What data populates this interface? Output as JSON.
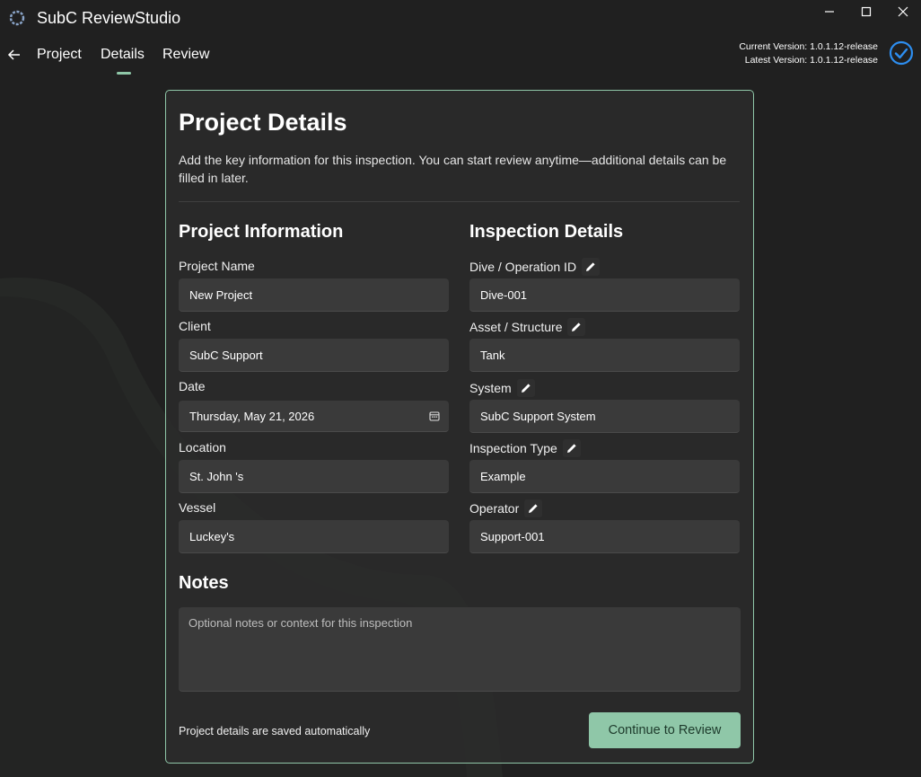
{
  "window": {
    "title": "SubC ReviewStudio"
  },
  "nav": {
    "tabs": [
      {
        "label": "Project"
      },
      {
        "label": "Details"
      },
      {
        "label": "Review"
      }
    ]
  },
  "version": {
    "current": "Current Version: 1.0.1.12-release",
    "latest": "Latest Version: 1.0.1.12-release"
  },
  "card": {
    "title": "Project Details",
    "description": "Add the key information for this inspection. You can start review anytime—additional details can be filled in later."
  },
  "project_info": {
    "heading": "Project Information",
    "fields": [
      {
        "label": "Project Name",
        "value": "New Project"
      },
      {
        "label": "Client",
        "value": "SubC Support"
      },
      {
        "label": "Date",
        "value": "Thursday, May 21, 2026"
      },
      {
        "label": "Location",
        "value": "St. John 's"
      },
      {
        "label": "Vessel",
        "value": "Luckey's"
      }
    ]
  },
  "inspection": {
    "heading": "Inspection Details",
    "fields": [
      {
        "label": "Dive / Operation ID",
        "value": "Dive-001"
      },
      {
        "label": "Asset / Structure",
        "value": "Tank"
      },
      {
        "label": "System",
        "value": "SubC Support System"
      },
      {
        "label": "Inspection Type",
        "value": "Example"
      },
      {
        "label": "Operator",
        "value": "Support-001"
      }
    ]
  },
  "notes": {
    "heading": "Notes",
    "placeholder": "Optional notes or context for this inspection"
  },
  "footer": {
    "autosave": "Project details are saved automatically",
    "continue_label": "Continue to Review"
  },
  "colors": {
    "accent": "#8fc7a8",
    "background": "#202020",
    "field": "#3a3a3a",
    "status_blue": "#2d8ef0"
  }
}
